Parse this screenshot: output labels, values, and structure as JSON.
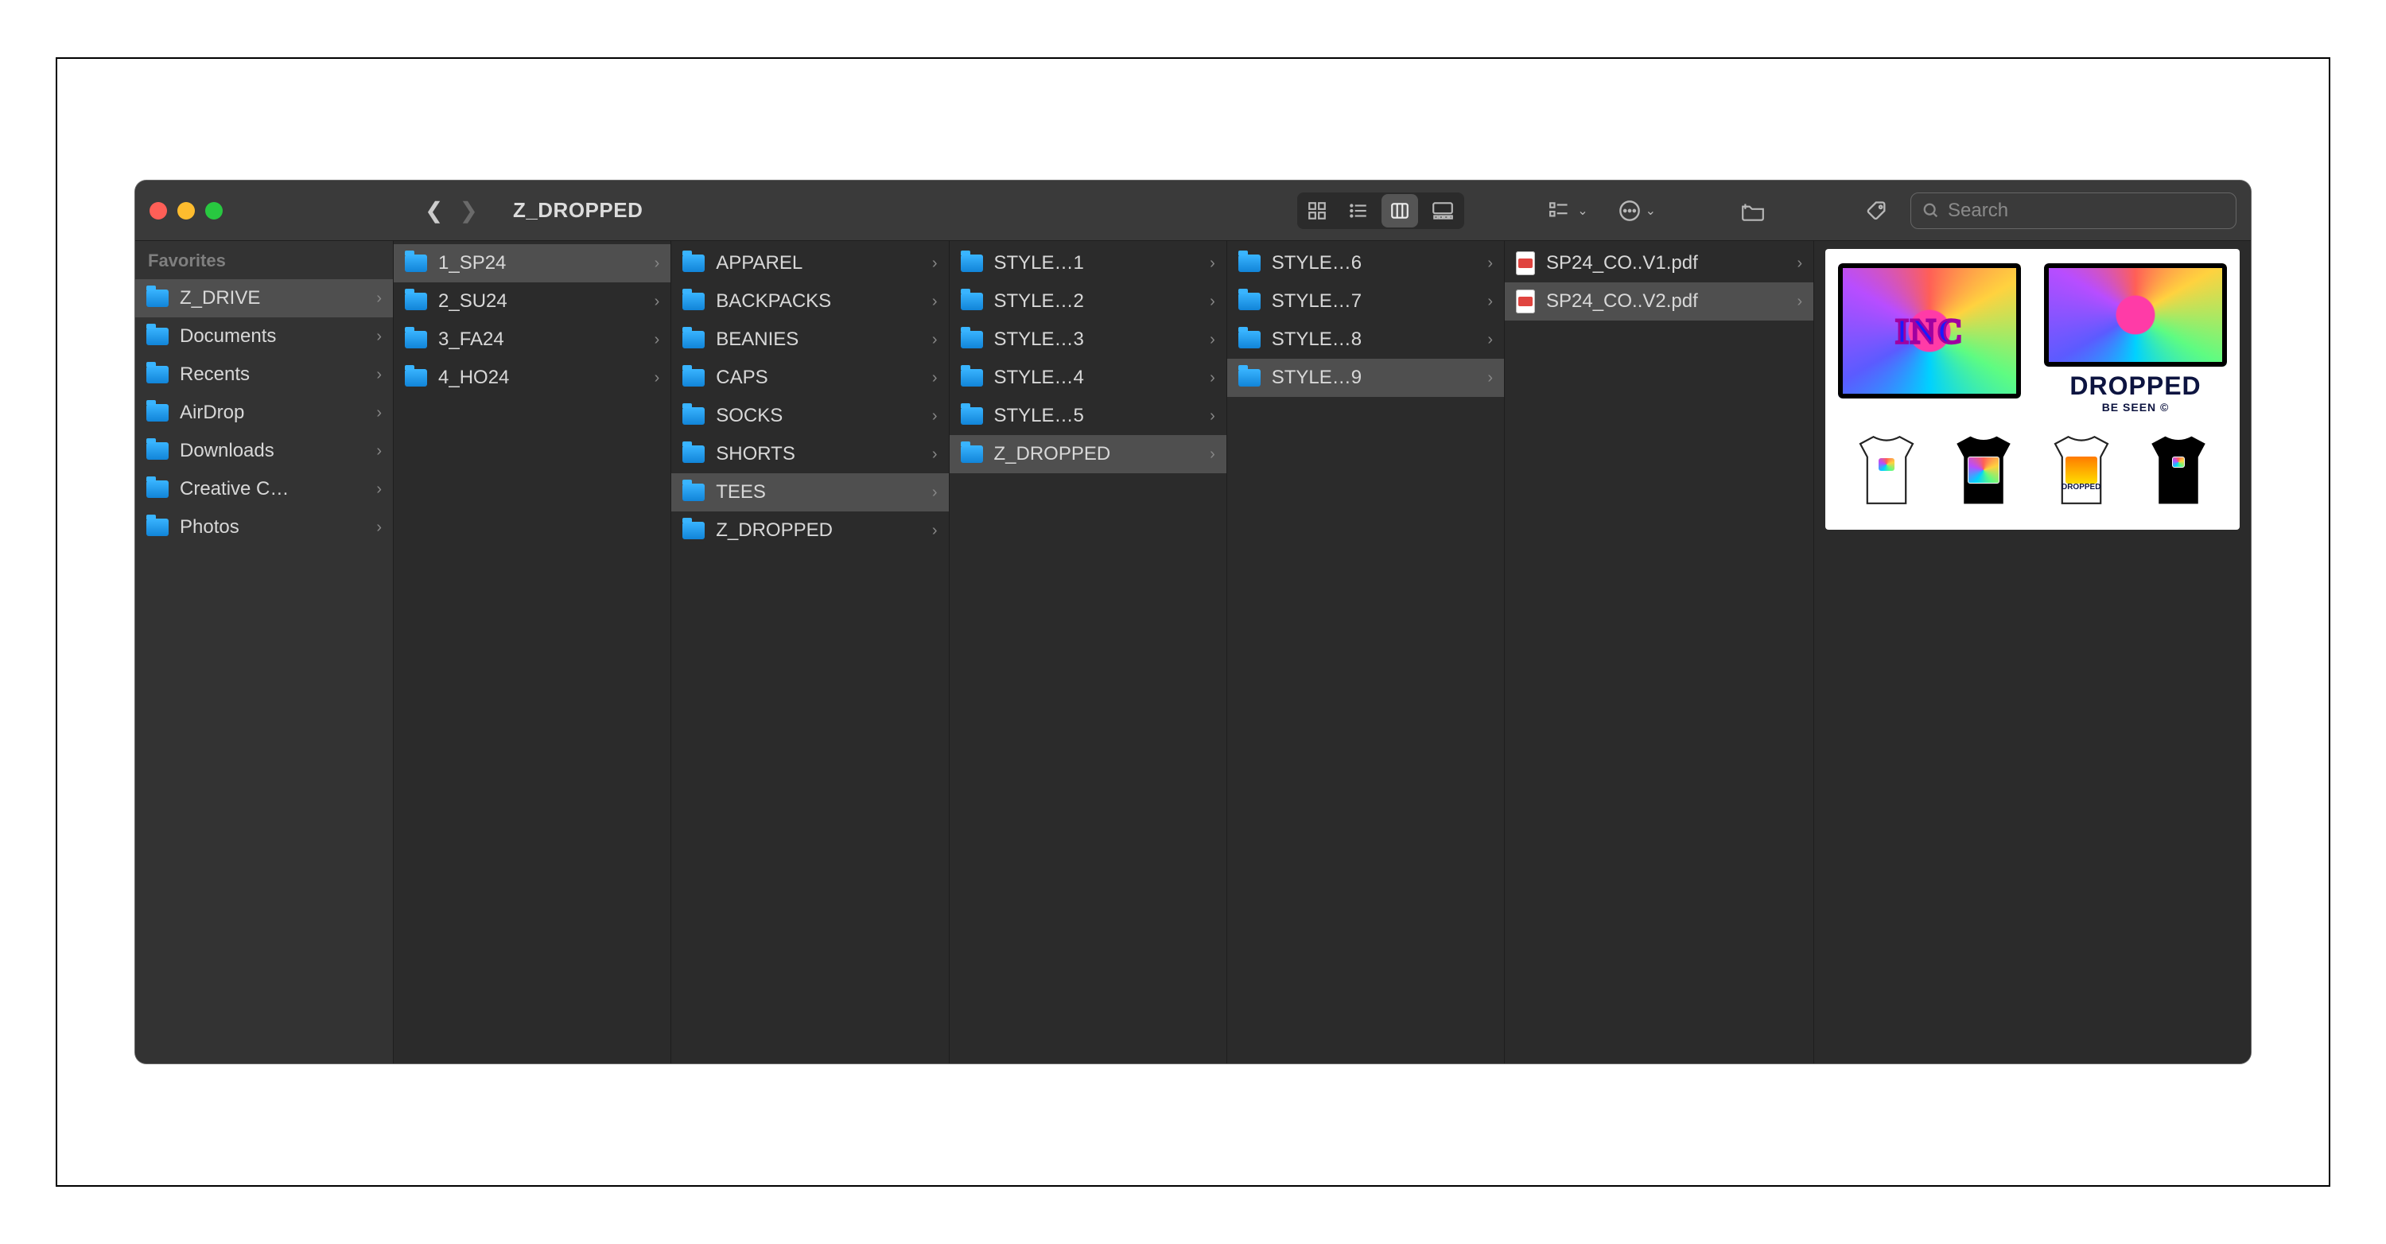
{
  "window": {
    "title": "Z_DROPPED"
  },
  "search": {
    "placeholder": "Search"
  },
  "sidebar": {
    "header": "Favorites",
    "items": [
      {
        "label": "Z_DRIVE",
        "selected": true
      },
      {
        "label": "Documents"
      },
      {
        "label": "Recents"
      },
      {
        "label": "AirDrop"
      },
      {
        "label": "Downloads"
      },
      {
        "label": "Creative C…"
      },
      {
        "label": "Photos"
      }
    ]
  },
  "columns": [
    {
      "items": [
        {
          "label": "1_SP24",
          "selected": true
        },
        {
          "label": "2_SU24"
        },
        {
          "label": "3_FA24"
        },
        {
          "label": "4_HO24"
        }
      ]
    },
    {
      "items": [
        {
          "label": "APPAREL"
        },
        {
          "label": "BACKPACKS"
        },
        {
          "label": "BEANIES"
        },
        {
          "label": "CAPS"
        },
        {
          "label": "SOCKS"
        },
        {
          "label": "SHORTS"
        },
        {
          "label": "TEES",
          "selected": true
        },
        {
          "label": "Z_DROPPED"
        }
      ]
    },
    {
      "items": [
        {
          "label": "STYLE…1"
        },
        {
          "label": "STYLE…2"
        },
        {
          "label": "STYLE…3"
        },
        {
          "label": "STYLE…4"
        },
        {
          "label": "STYLE…5"
        },
        {
          "label": "Z_DROPPED",
          "selected": true
        }
      ]
    },
    {
      "items": [
        {
          "label": "STYLE…6"
        },
        {
          "label": "STYLE…7"
        },
        {
          "label": "STYLE…8"
        },
        {
          "label": "STYLE…9",
          "selected": true
        }
      ]
    },
    {
      "items": [
        {
          "label": "SP24_CO..V1.pdf",
          "type": "file"
        },
        {
          "label": "SP24_CO..V2.pdf",
          "type": "file",
          "selected": true
        }
      ]
    }
  ],
  "preview": {
    "logo1": "INC",
    "dropped": "DROPPED",
    "tagline": "BE SEEN ©",
    "tee3_line1": "DROPPED"
  }
}
